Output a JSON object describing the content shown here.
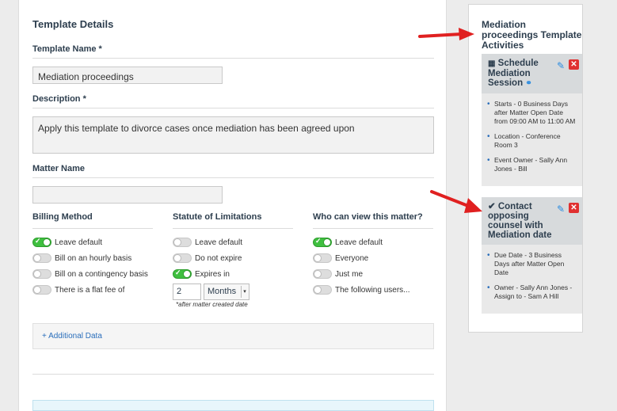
{
  "template_details": {
    "section_title": "Template Details",
    "template_name_label": "Template Name *",
    "template_name_value": "Mediation proceedings",
    "description_label": "Description *",
    "description_value": "Apply this template to divorce cases once mediation has been agreed upon",
    "matter_name_label": "Matter Name",
    "matter_name_value": ""
  },
  "billing": {
    "title": "Billing Method",
    "options": [
      {
        "label": "Leave default",
        "on": true
      },
      {
        "label": "Bill on an hourly basis",
        "on": false
      },
      {
        "label": "Bill on a contingency basis",
        "on": false
      },
      {
        "label": "There is a flat fee of",
        "on": false
      }
    ]
  },
  "statute": {
    "title": "Statute of Limitations",
    "options": [
      {
        "label": "Leave default",
        "on": false
      },
      {
        "label": "Do not expire",
        "on": false
      },
      {
        "label": "Expires in",
        "on": true
      }
    ],
    "amount": "2",
    "unit": "Months",
    "note": "*after matter created date"
  },
  "visibility": {
    "title": "Who can view this matter?",
    "options": [
      {
        "label": "Leave default",
        "on": true
      },
      {
        "label": "Everyone",
        "on": false
      },
      {
        "label": "Just me",
        "on": false
      },
      {
        "label": "The following users...",
        "on": false
      }
    ]
  },
  "additional_data": {
    "label": "+ Additional Data"
  },
  "activities": {
    "title": "Mediation proceedings Template Activities",
    "cards": [
      {
        "icon": "calendar-icon",
        "title": "Schedule Mediation Session",
        "items": [
          "Starts - 0 Business Days after Matter Open Date from 09:00 AM to 11:00 AM",
          "Location - Conference Room 3",
          "Event Owner - Sally Ann Jones - Bill"
        ]
      },
      {
        "icon": "checkmark-icon",
        "title": "Contact opposing counsel with Mediation date",
        "items": [
          "Due Date - 3 Business Days after Matter Open Date",
          "Owner - Sally Ann Jones - Assign to - Sam A Hill"
        ]
      }
    ]
  },
  "colors": {
    "arrow": "#e02020",
    "toggle_on": "#3fbf3f",
    "link": "#2a6ebb"
  }
}
